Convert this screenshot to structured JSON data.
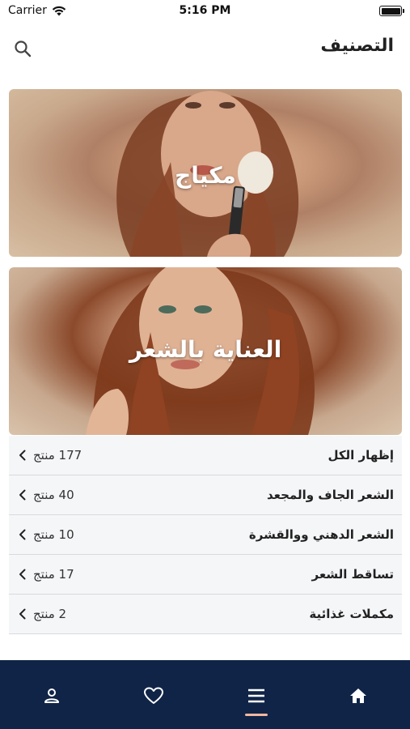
{
  "status_bar": {
    "carrier": "Carrier",
    "time": "5:16 PM"
  },
  "header": {
    "title": "التصنيف",
    "search_icon": "search-icon"
  },
  "banners": [
    {
      "label": "مكياج",
      "image": "woman-with-makeup-brush"
    },
    {
      "label": "العناية بالشعر",
      "image": "woman-with-wavy-hair"
    }
  ],
  "list": {
    "items": [
      {
        "name": "إظهار الكل",
        "count": "177 منتج"
      },
      {
        "name": "الشعر الجاف والمجعد",
        "count": "40 منتج"
      },
      {
        "name": "الشعر الدهني ووالقشرة",
        "count": "10 منتج"
      },
      {
        "name": "تساقط الشعر",
        "count": "17 منتج"
      },
      {
        "name": "مكملات غذائية",
        "count": "2 منتج"
      }
    ]
  },
  "tab_bar": {
    "tabs": [
      "profile-icon",
      "heart-icon",
      "menu-icon",
      "home-icon"
    ],
    "active": "menu-icon",
    "background": "#0f2447",
    "indicator_color": "#f2b8a0"
  }
}
